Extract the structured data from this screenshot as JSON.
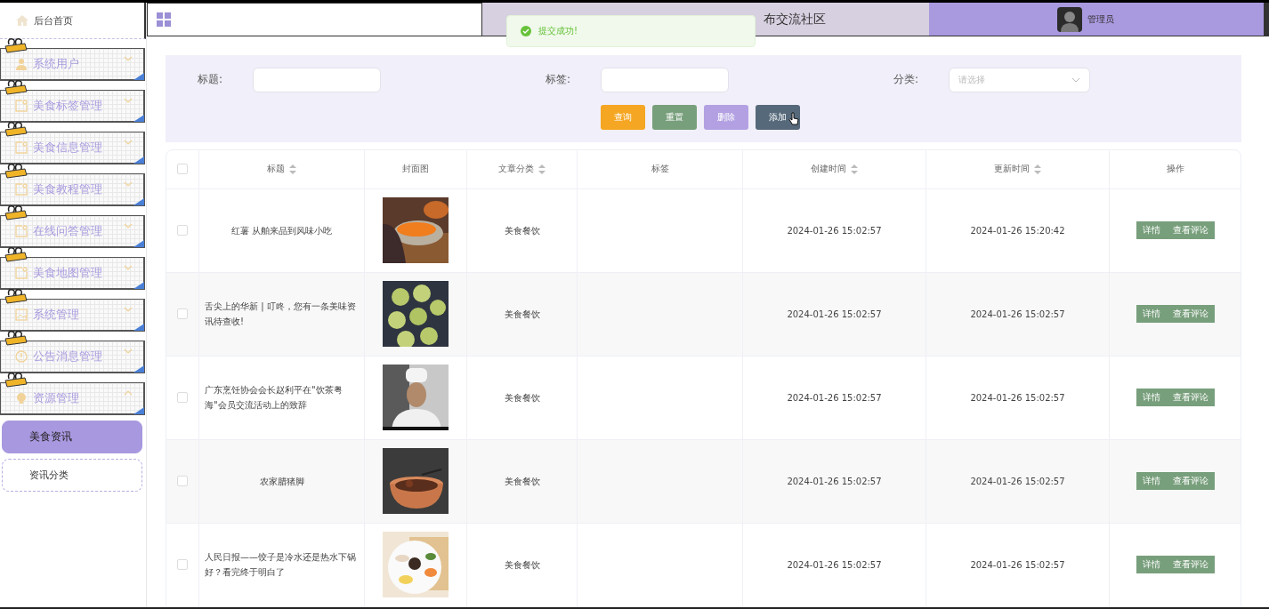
{
  "sidebar": {
    "home": {
      "label": "后台首页"
    },
    "menus": [
      {
        "label": "系统用户",
        "expanded": false
      },
      {
        "label": "美食标签管理",
        "expanded": false
      },
      {
        "label": "美食信息管理",
        "expanded": false
      },
      {
        "label": "美食教程管理",
        "expanded": false
      },
      {
        "label": "在线问答管理",
        "expanded": false
      },
      {
        "label": "美食地图管理",
        "expanded": false
      },
      {
        "label": "系统管理",
        "expanded": false
      },
      {
        "label": "公告消息管理",
        "expanded": false
      },
      {
        "label": "资源管理",
        "expanded": true,
        "children": [
          {
            "label": "美食资讯",
            "selected": true
          },
          {
            "label": "资讯分类",
            "selected": false
          }
        ]
      }
    ]
  },
  "header": {
    "title": "布交流社区",
    "user": "管理员"
  },
  "toast": {
    "message": "提交成功!"
  },
  "filters": [
    {
      "label": "标题:",
      "kind": "input"
    },
    {
      "label": "标签:",
      "kind": "input"
    },
    {
      "label": "分类:",
      "kind": "select",
      "placeholder": "请选择"
    }
  ],
  "buttons": [
    {
      "label": "查询",
      "color": "#f5a623"
    },
    {
      "label": "重置",
      "color": "#789f7c"
    },
    {
      "label": "删除",
      "color": "#b2a0e2"
    },
    {
      "label": "添加",
      "color": "#56697a"
    }
  ],
  "table": {
    "select_all": {
      "checked": false
    },
    "columns": [
      {
        "label": "标题",
        "sortable": true
      },
      {
        "label": "封面图",
        "sortable": false
      },
      {
        "label": "文章分类",
        "sortable": true
      },
      {
        "label": "标签",
        "sortable": false
      },
      {
        "label": "创建时间",
        "sortable": true
      },
      {
        "label": "更新时间",
        "sortable": true
      },
      {
        "label": "操作",
        "sortable": false
      }
    ],
    "rows": [
      {
        "checked": false,
        "title": "红薯 从舶来品到风味小吃",
        "category": "美食餐饮",
        "created": "2024-01-26 15:02:57",
        "updated": "2024-01-26 15:20:42",
        "actions": [
          "详情",
          "查看评论"
        ]
      },
      {
        "checked": false,
        "title": "舌尖上的华新 | 叮咚，您有一条美味资讯待查收!",
        "category": "美食餐饮",
        "created": "2024-01-26 15:02:57",
        "updated": "2024-01-26 15:02:57",
        "actions": [
          "详情",
          "查看评论"
        ]
      },
      {
        "checked": false,
        "title": "广东烹饪协会会长赵利平在\"饮茶粤海\"会员交流活动上的致辞",
        "category": "美食餐饮",
        "created": "2024-01-26 15:02:57",
        "updated": "2024-01-26 15:02:57",
        "actions": [
          "详情",
          "查看评论"
        ]
      },
      {
        "checked": false,
        "title": "农家腊猪脚",
        "category": "美食餐饮",
        "created": "2024-01-26 15:02:57",
        "updated": "2024-01-26 15:02:57",
        "actions": [
          "详情",
          "查看评论"
        ]
      },
      {
        "checked": false,
        "title": "人民日报——饺子是冷水还是热水下锅好？看完终于明白了",
        "category": "美食餐饮",
        "created": "2024-01-26 15:02:57",
        "updated": "2024-01-26 15:02:57",
        "actions": [
          "详情",
          "查看评论"
        ]
      }
    ]
  }
}
